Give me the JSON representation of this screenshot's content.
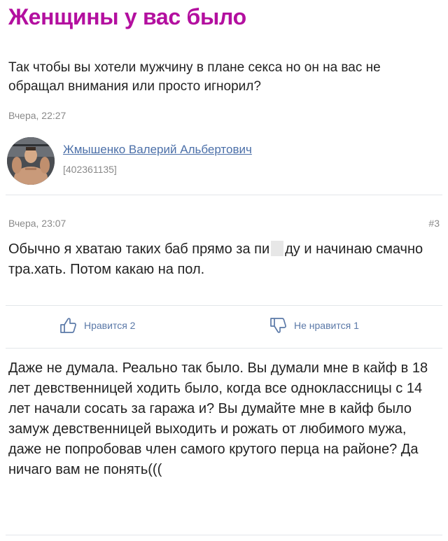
{
  "topic": {
    "title": "Женщины у вас было",
    "text": "Так чтобы вы хотели мужчину в плане секса но он на вас не обращал внимания или просто игнорил?",
    "date": "Вчера, 22:27"
  },
  "author": {
    "name": "Жмышенко Валерий Альбертович",
    "id": "[402361135]"
  },
  "comment": {
    "date": "Вчера, 23:07",
    "number": "#3",
    "text_before": "Обычно я хватаю таких баб прямо за пи",
    "text_after": "ду и начинаю смачно тра.хать. Потом какаю на пол."
  },
  "votes": {
    "like_label": "Нравится 2",
    "dislike_label": "Не нравится 1"
  },
  "reply": {
    "text": "Даже не думала. Реально так было. Вы думали мне в кайф в 18 лет девственницей ходить было, когда все одноклассницы с 14 лет начали сосать за гаража и? Вы думайте мне в кайф было замуж девственницей выходить и рожать от любимого мужа, даже не попробовав член самого крутого перца на районе? Да ничаго вам не понять((("
  },
  "colors": {
    "title": "#b30f9f",
    "link": "#4b6fa8",
    "meta": "#8a8a8a",
    "vote": "#5b79a8"
  }
}
